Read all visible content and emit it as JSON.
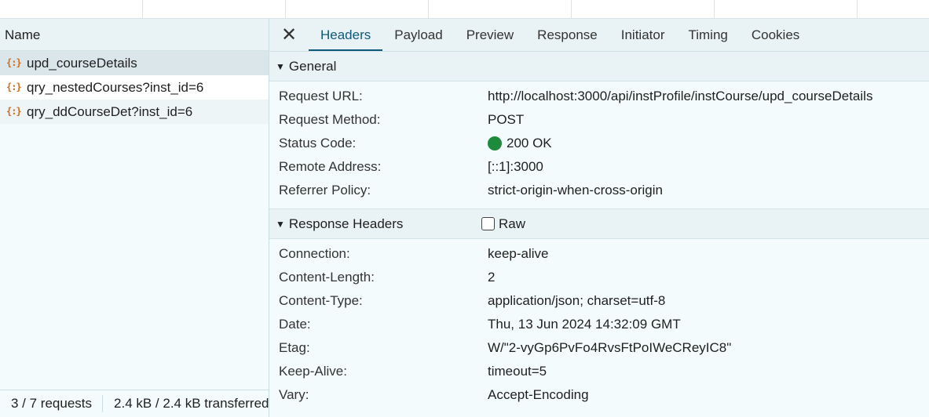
{
  "request_list": {
    "header": "Name",
    "items": [
      {
        "name": "upd_courseDetails",
        "icon": "json-file-icon"
      },
      {
        "name": "qry_nestedCourses?inst_id=6",
        "icon": "json-file-icon"
      },
      {
        "name": "qry_ddCourseDet?inst_id=6",
        "icon": "json-file-icon"
      }
    ]
  },
  "status_bar": {
    "requests": "3 / 7 requests",
    "transferred": "2.4 kB / 2.4 kB transferred"
  },
  "detail": {
    "close_icon": "close-icon",
    "tabs": [
      "Headers",
      "Payload",
      "Preview",
      "Response",
      "Initiator",
      "Timing",
      "Cookies"
    ],
    "active_tab": "Headers",
    "general": {
      "title": "General",
      "rows": [
        {
          "key": "Request URL:",
          "value": "http://localhost:3000/api/instProfile/instCourse/upd_courseDetails"
        },
        {
          "key": "Request Method:",
          "value": "POST"
        },
        {
          "key": "Status Code:",
          "value": "200 OK"
        },
        {
          "key": "Remote Address:",
          "value": "[::1]:3000"
        },
        {
          "key": "Referrer Policy:",
          "value": "strict-origin-when-cross-origin"
        }
      ]
    },
    "response_headers": {
      "title": "Response Headers",
      "raw_label": "Raw",
      "rows": [
        {
          "key": "Connection:",
          "value": "keep-alive"
        },
        {
          "key": "Content-Length:",
          "value": "2"
        },
        {
          "key": "Content-Type:",
          "value": "application/json; charset=utf-8"
        },
        {
          "key": "Date:",
          "value": "Thu, 13 Jun 2024 14:32:09 GMT"
        },
        {
          "key": "Etag:",
          "value": "W/\"2-vyGp6PvFo4RvsFtPoIWeCReyIC8\""
        },
        {
          "key": "Keep-Alive:",
          "value": "timeout=5"
        },
        {
          "key": "Vary:",
          "value": "Accept-Encoding"
        }
      ]
    }
  },
  "colors": {
    "status_ok": "#1e8a3c",
    "json_icon": "#d66a17",
    "active_tab": "#0f5a7a"
  }
}
